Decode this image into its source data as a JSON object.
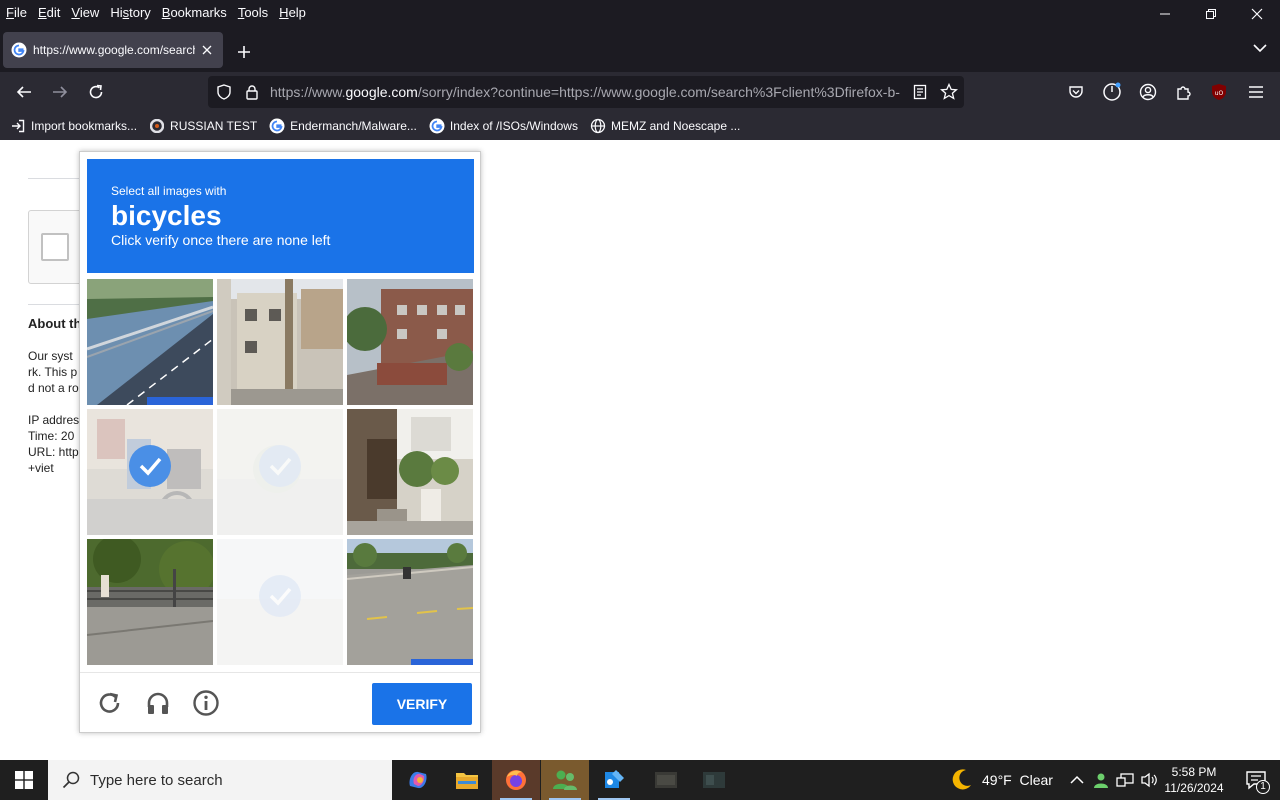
{
  "menubar": {
    "items": [
      {
        "ul": "F",
        "rest": "ile"
      },
      {
        "ul": "E",
        "rest": "dit"
      },
      {
        "ul": "V",
        "rest": "iew"
      },
      {
        "pre": "Hi",
        "ul": "s",
        "rest": "tory"
      },
      {
        "ul": "B",
        "rest": "ookmarks"
      },
      {
        "ul": "T",
        "rest": "ools"
      },
      {
        "ul": "H",
        "rest": "elp"
      }
    ]
  },
  "tab": {
    "title": "https://www.google.com/search"
  },
  "urlbar": {
    "prefix": "https://www.",
    "host": "google.com",
    "rest": "/sorry/index?continue=https://www.google.com/search%3Fclient%3Dfirefox-b-"
  },
  "bookmarks": [
    {
      "label": "Import bookmarks...",
      "icon": "import-icon"
    },
    {
      "label": "RUSSIAN TEST",
      "icon": "site-icon"
    },
    {
      "label": "Endermanch/Malware...",
      "icon": "google-icon"
    },
    {
      "label": "Index of /ISOs/Windows",
      "icon": "google-icon"
    },
    {
      "label": "MEMZ and Noescape ...",
      "icon": "globe-icon"
    }
  ],
  "page": {
    "about_title": "About th",
    "lines": [
      "Our syst",
      "rk. This p",
      "d not a ro",
      "",
      "IP addres",
      "Time: 20",
      "URL: http",
      "+viet"
    ]
  },
  "captcha": {
    "instruction_small": "Select all images with",
    "instruction_target": "bicycles",
    "instruction_sub": "Click verify once there are none left",
    "verify_label": "VERIFY",
    "tiles": [
      {
        "state": "normal"
      },
      {
        "state": "normal"
      },
      {
        "state": "normal"
      },
      {
        "state": "selected"
      },
      {
        "state": "faded"
      },
      {
        "state": "normal"
      },
      {
        "state": "normal"
      },
      {
        "state": "faded"
      },
      {
        "state": "normal"
      }
    ]
  },
  "taskbar": {
    "search_placeholder": "Type here to search",
    "weather": "49°F  Clear",
    "time": "5:58 PM",
    "date": "11/26/2024",
    "notification_count": "1"
  },
  "colors": {
    "accent": "#1a73e8",
    "chrome_dark": "#1c1b22",
    "toolbar": "#2b2a33"
  }
}
